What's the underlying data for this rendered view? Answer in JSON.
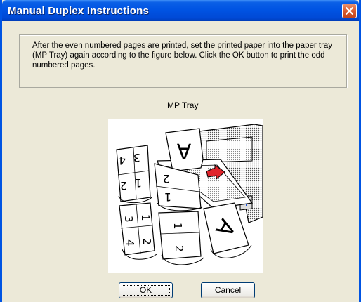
{
  "window": {
    "title": "Manual Duplex Instructions"
  },
  "instructions": "After the even numbered pages are printed, set the printed paper into the paper tray (MP Tray) again according to the figure below. Click the OK button to print the odd numbered pages.",
  "tray_label": "MP Tray",
  "figure": {
    "page_letter": "A",
    "page_numbers": [
      "4",
      "3",
      "2",
      "1",
      "2",
      "1",
      "3",
      "4",
      "1",
      "2",
      "1",
      "2"
    ]
  },
  "buttons": {
    "ok": "OK",
    "cancel": "Cancel"
  },
  "colors": {
    "titlebar": "#0054E3",
    "dialog_bg": "#ECE9D8",
    "close_button": "#D95B2F",
    "arrow": "#E0242B"
  },
  "icons": {
    "close": "close-icon"
  }
}
